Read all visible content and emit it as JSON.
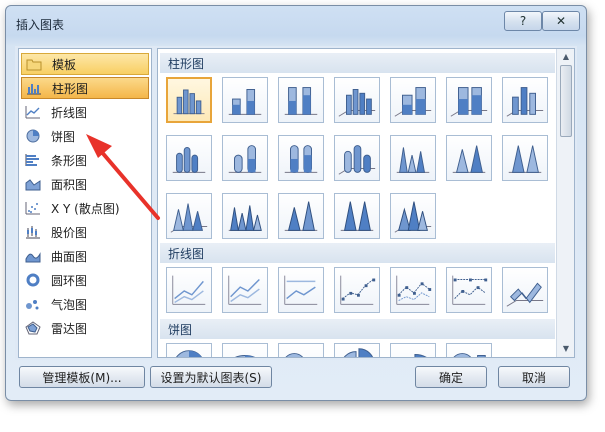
{
  "dialog": {
    "title": "插入图表",
    "help_label": "?",
    "close_label": "✕"
  },
  "categories": [
    {
      "label": "模板",
      "icon": "folder-icon"
    },
    {
      "label": "柱形图",
      "icon": "column-chart-icon"
    },
    {
      "label": "折线图",
      "icon": "line-chart-icon"
    },
    {
      "label": "饼图",
      "icon": "pie-chart-icon"
    },
    {
      "label": "条形图",
      "icon": "bar-chart-icon"
    },
    {
      "label": "面积图",
      "icon": "area-chart-icon"
    },
    {
      "label": "X Y (散点图)",
      "icon": "scatter-chart-icon"
    },
    {
      "label": "股价图",
      "icon": "stock-chart-icon"
    },
    {
      "label": "曲面图",
      "icon": "surface-chart-icon"
    },
    {
      "label": "圆环图",
      "icon": "doughnut-chart-icon"
    },
    {
      "label": "气泡图",
      "icon": "bubble-chart-icon"
    },
    {
      "label": "雷达图",
      "icon": "radar-chart-icon"
    }
  ],
  "sections": {
    "column": "柱形图",
    "line": "折线图",
    "pie": "饼图"
  },
  "buttons": {
    "manage_templates": "管理模板(M)...",
    "set_default": "设置为默认图表(S)",
    "ok": "确定",
    "cancel": "取消"
  },
  "colors": {
    "selection": "#f8cf63",
    "chart_blue": "#4f7fc4",
    "annotation_arrow": "#e8322a"
  }
}
